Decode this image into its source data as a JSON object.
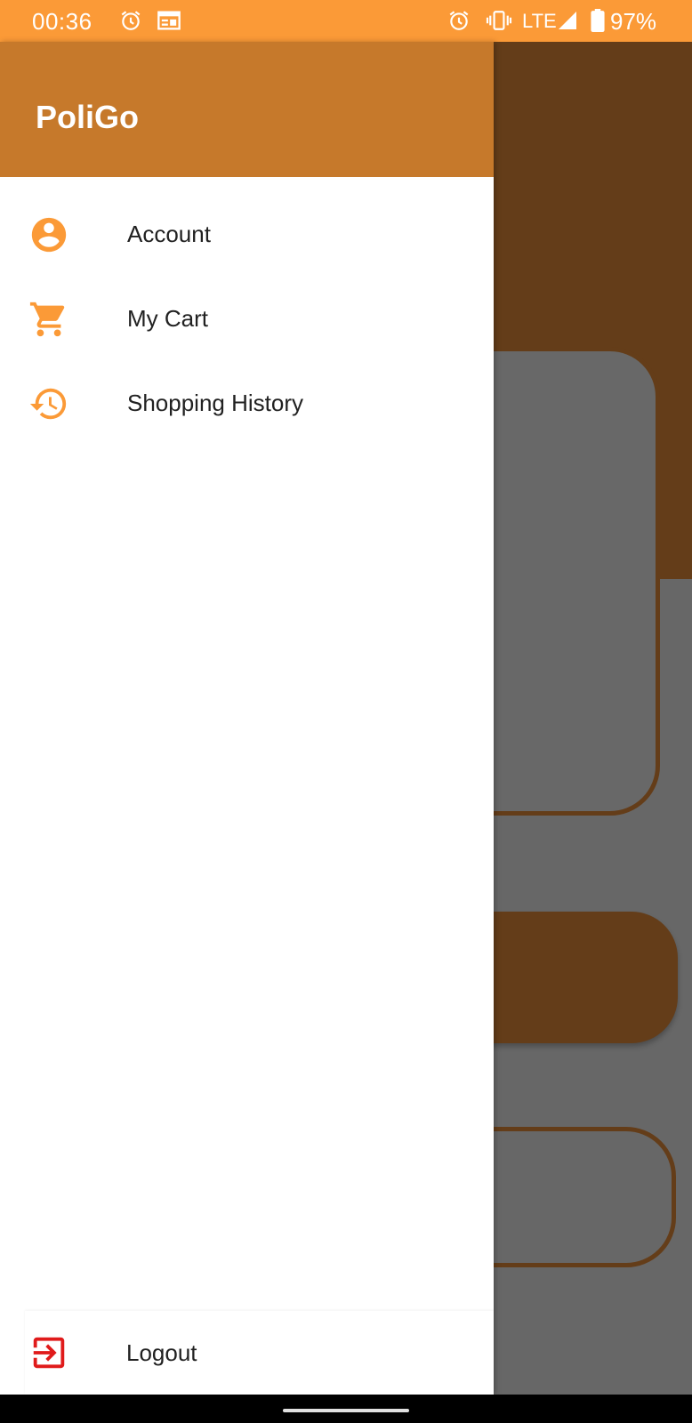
{
  "status_bar": {
    "time": "00:36",
    "network": "LTE",
    "battery": "97%",
    "icons": [
      "alarm-icon",
      "calendar-icon",
      "alarm-icon",
      "vibrate-icon",
      "signal-icon",
      "battery-icon"
    ]
  },
  "drawer": {
    "title": "PoliGo",
    "items": [
      {
        "label": "Account",
        "icon": "account-circle-icon"
      },
      {
        "label": "My Cart",
        "icon": "cart-icon"
      },
      {
        "label": "Shopping History",
        "icon": "history-icon"
      }
    ],
    "logout": {
      "label": "Logout",
      "icon": "exit-icon"
    }
  },
  "colors": {
    "status_bar": "#fb9a37",
    "header": "#c6792b",
    "icon_accent": "#fb9a37",
    "logout_icon": "#e01b1b",
    "background_brown": "#643d19",
    "scrim_gray": "#676767"
  }
}
